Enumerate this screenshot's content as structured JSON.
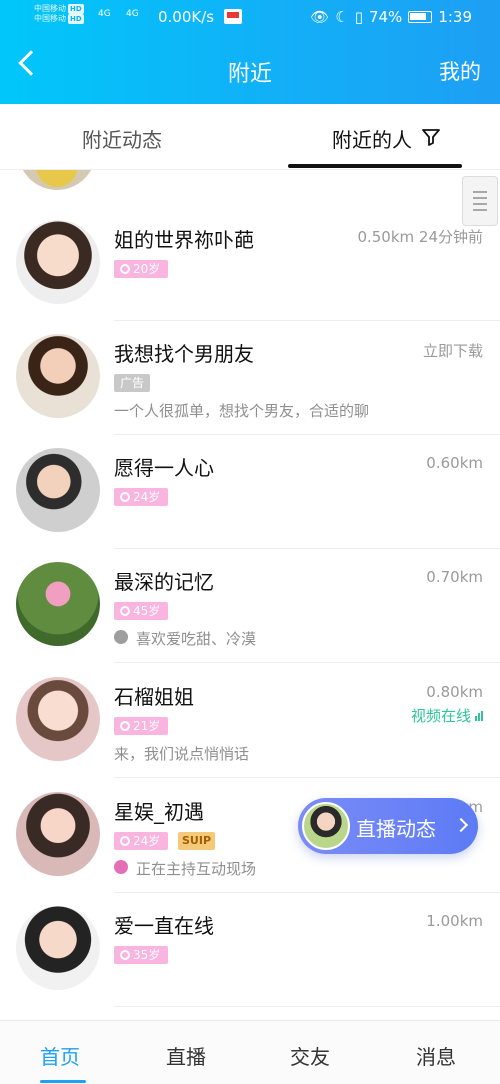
{
  "status_bar": {
    "carrier1": "中国移动",
    "carrier2": "中国移动",
    "hd": "HD",
    "signal": "4G",
    "signal2": "4G",
    "speed": "0.00K/s",
    "battery": "74%",
    "time": "1:39"
  },
  "header": {
    "title": "附近",
    "right_label": "我的"
  },
  "tabs": [
    {
      "label": "附近动态",
      "active": false
    },
    {
      "label": "附近的人",
      "active": true
    }
  ],
  "people": [
    {
      "name": "姐的世界祢卟葩",
      "distance": "0.50km 24分钟前",
      "age": "20岁",
      "desc": ""
    },
    {
      "name": "我想找个男朋友",
      "distance": "立即下载",
      "ad_label": "广告",
      "desc": "一个人很孤单，想找个男友，合适的聊"
    },
    {
      "name": "愿得一人心",
      "distance": "0.60km",
      "age": "24岁",
      "desc": ""
    },
    {
      "name": "最深的记忆",
      "distance": "0.70km",
      "age": "45岁",
      "desc": "喜欢爱吃甜、冷漠"
    },
    {
      "name": "石榴姐姐",
      "distance": "0.80km",
      "age": "21岁",
      "status": "视频在线",
      "desc": "来，我们说点悄悄话"
    },
    {
      "name": "星娱_初遇",
      "distance": "0.90km",
      "age": "24岁",
      "badge": "SUIP",
      "desc": "正在主持互动现场"
    },
    {
      "name": "爱一直在线",
      "distance": "1.00km",
      "age": "35岁",
      "desc": ""
    }
  ],
  "live_bubble": {
    "label": "直播动态"
  },
  "bottom_nav": [
    {
      "label": "首页",
      "active": true
    },
    {
      "label": "直播",
      "active": false
    },
    {
      "label": "交友",
      "active": false
    },
    {
      "label": "消息",
      "active": false
    }
  ],
  "colors": {
    "header_start": "#00c7fa",
    "header_end": "#1d9ff4",
    "accent": "#1da1f2",
    "age_tag": "#f9b4e0",
    "video_online": "#2ec59a"
  },
  "icons": {
    "back": "back-arrow-icon",
    "filter": "filter-funnel-icon",
    "gender": "gender-icon",
    "signal_bars": "signal-bars-icon"
  }
}
